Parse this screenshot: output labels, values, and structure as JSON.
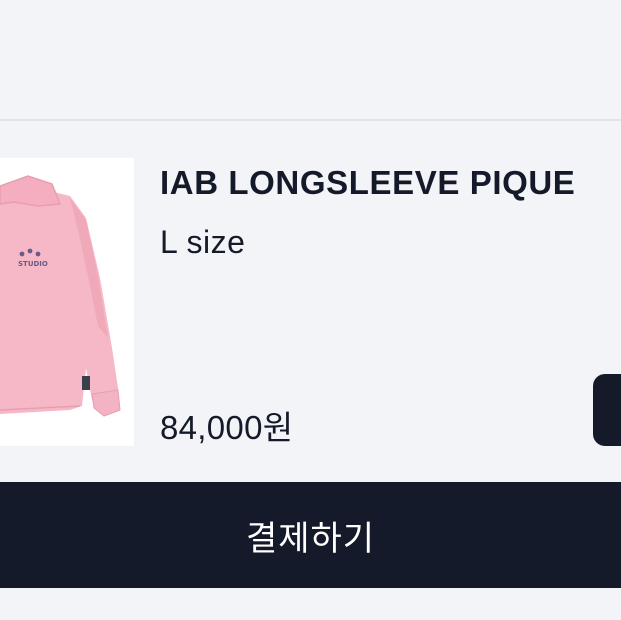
{
  "cart_item": {
    "name": "IAB LONGSLEEVE PIQUE",
    "option": "L size",
    "price": "84,000원",
    "image": {
      "icon": "pink-longsleeve-polo-shirt",
      "shirt_color": "#f6b8c6",
      "shirt_shade": "#e79fb0",
      "logo_text": "STUDIO"
    }
  },
  "checkout": {
    "label": "결제하기"
  },
  "colors": {
    "background": "#f3f4f7",
    "primary_dark": "#141a2a",
    "text": "#141a2a",
    "divider": "#e2e4e8"
  }
}
